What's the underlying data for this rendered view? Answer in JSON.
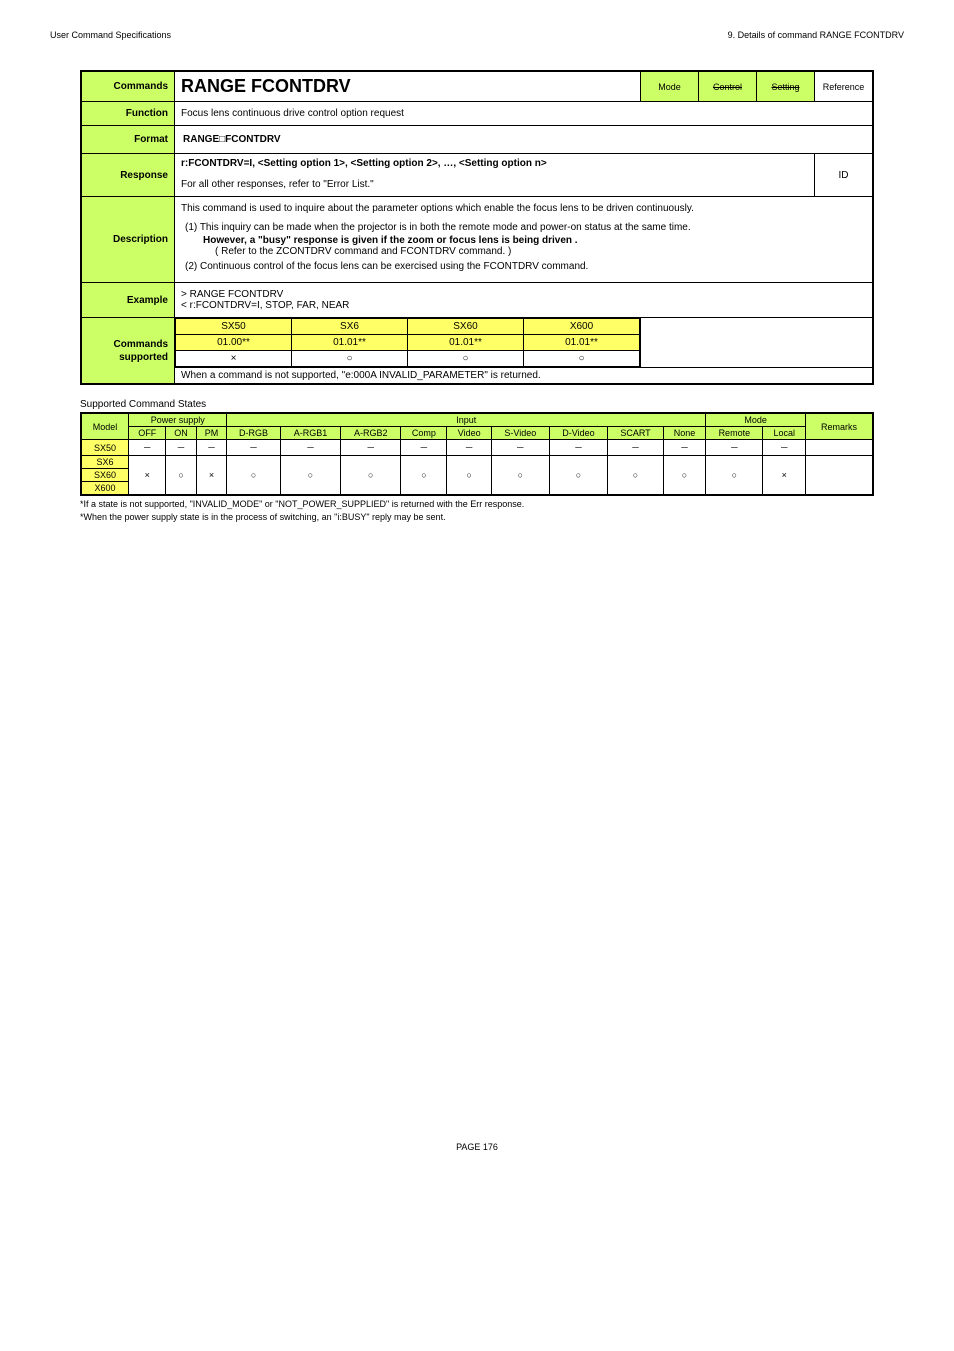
{
  "header": {
    "left": "User Command Specifications",
    "right": "9. Details of command  RANGE FCONTDRV"
  },
  "main": {
    "commands_label": "Commands",
    "command_name": "RANGE FCONTDRV",
    "badges": {
      "mode": "Mode",
      "control": "Control",
      "setting": "Setting",
      "reference": "Reference"
    },
    "function_label": "Function",
    "function_text": "Focus lens continuous drive control option request",
    "format_label": "Format",
    "format_text": "RANGE□FCONTDRV",
    "response_label": "Response",
    "response_line1": "r:FCONTDRV=I, <Setting option 1>, <Setting option 2>, …, <Setting option n>",
    "response_line2_pre": "For all other responses, refer to ",
    "response_line2_link": "\"Error List.\"",
    "response_id": "ID",
    "description_label": "Description",
    "description_intro": "This command is used to inquire about the parameter options which enable the focus lens to be driven continuously.",
    "description_items": [
      {
        "text": "This inquiry can be made when the projector is in both the remote mode and power-on status at the same time.",
        "sub1": "However, a \"busy\" response is given if the zoom or focus lens is being driven  .",
        "sub2": "( Refer to the ZCONTDRV command and FCONTDRV command.  )"
      },
      {
        "text": "Continuous control of the focus lens can be exercised using the FCONTDRV command."
      }
    ],
    "example_label": "Example",
    "example_line1": "> RANGE FCONTDRV",
    "example_line2": "< r:FCONTDRV=I, STOP, FAR, NEAR",
    "supported_label1": "Commands",
    "supported_label2": "supported",
    "supported_models": [
      {
        "name": "SX50",
        "ver": "01.00**",
        "mark": "×"
      },
      {
        "name": "SX6",
        "ver": "01.01**",
        "mark": "○"
      },
      {
        "name": "SX60",
        "ver": "01.01**",
        "mark": "○"
      },
      {
        "name": "X600",
        "ver": "01.01**",
        "mark": "○"
      }
    ],
    "supported_note": "When a command is not supported, \"e:000A INVALID_PARAMETER\" is returned."
  },
  "states": {
    "caption": "Supported Command States",
    "headers": {
      "model": "Model",
      "power": "Power supply",
      "input": "Input",
      "mode": "Mode",
      "remarks": "Remarks",
      "off": "OFF",
      "on": "ON",
      "pm": "PM",
      "drgb": "D-RGB",
      "argb1": "A-RGB1",
      "argb2": "A-RGB2",
      "comp": "Comp",
      "video": "Video",
      "svideo": "S-Video",
      "dvideo": "D-Video",
      "scart": "SCART",
      "none": "None",
      "remote": "Remote",
      "local": "Local"
    },
    "rows": [
      {
        "model": "SX50",
        "cells": [
          "－",
          "－",
          "－",
          "－",
          "－",
          "－",
          "－",
          "－",
          "－",
          "－",
          "－",
          "－",
          "－",
          "－"
        ]
      },
      {
        "model": "SX6",
        "cells": [
          "×",
          "○",
          "×",
          "○",
          "○",
          "○",
          "○",
          "○",
          "○",
          "○",
          "○",
          "○",
          "○",
          "×"
        ]
      },
      {
        "model": "SX60",
        "cells": [
          "",
          "",
          "",
          "",
          "",
          "",
          "",
          "",
          "",
          "",
          "",
          "",
          "",
          ""
        ]
      },
      {
        "model": "X600",
        "cells": [
          "",
          "",
          "",
          "",
          "",
          "",
          "",
          "",
          "",
          "",
          "",
          "",
          "",
          ""
        ]
      }
    ],
    "foot1": "*If a state is not supported, \"INVALID_MODE\" or \"NOT_POWER_SUPPLIED\" is returned with the Err response.",
    "foot2": "*When the power supply state is in the process of switching, an \"i:BUSY\" reply may be sent."
  },
  "page_num": "PAGE 176"
}
